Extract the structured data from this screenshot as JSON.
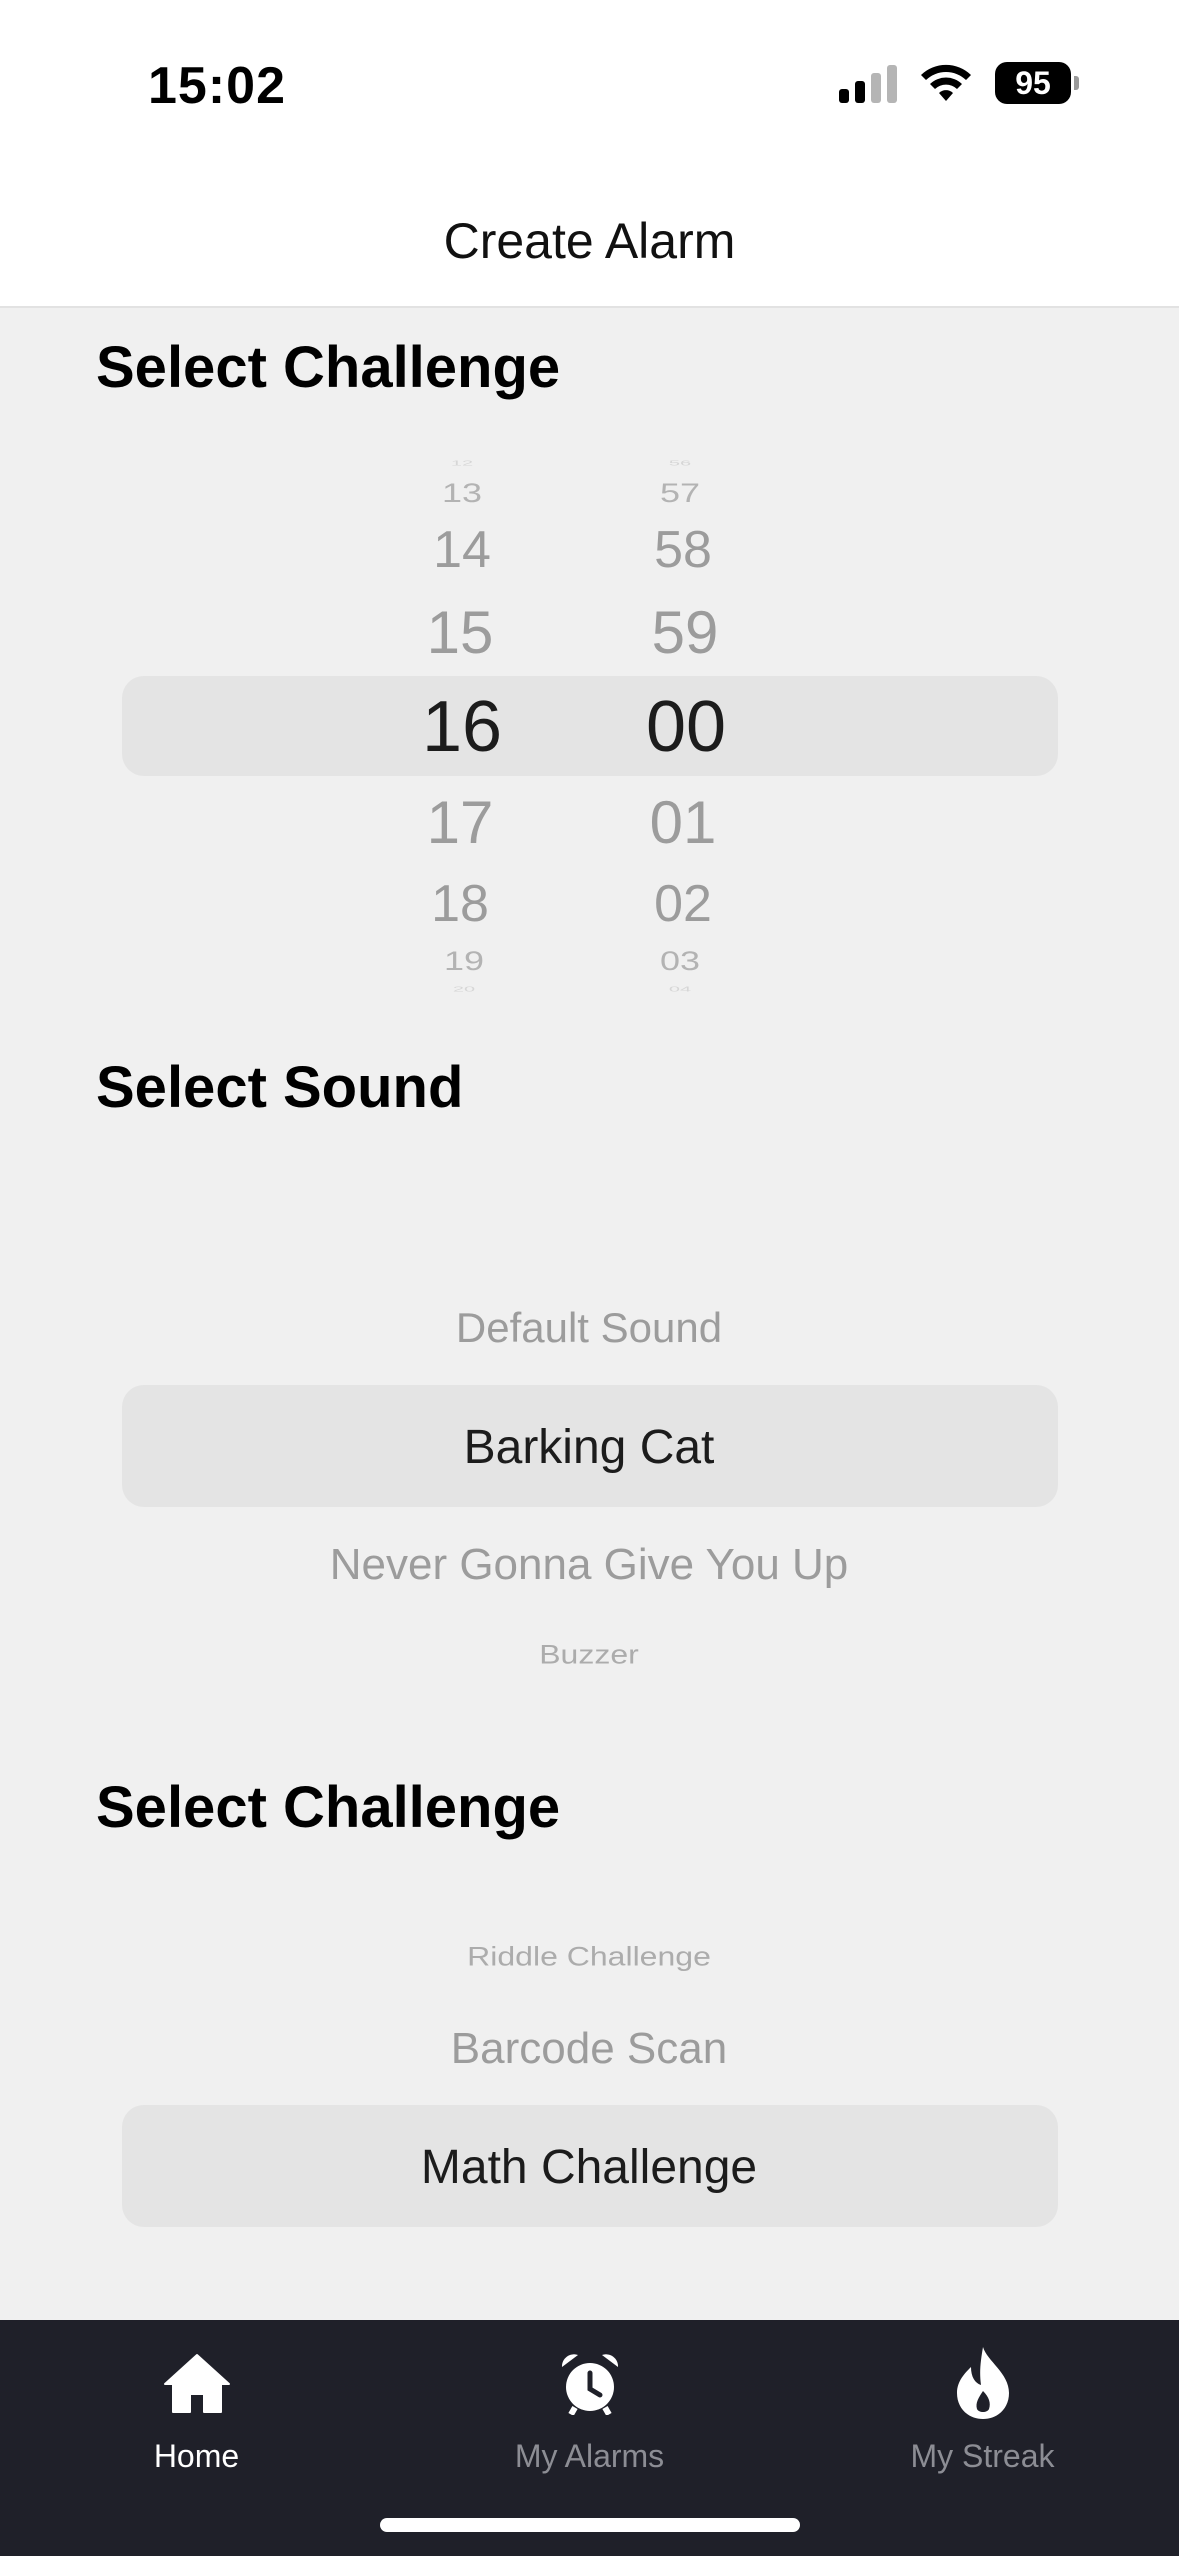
{
  "status_bar": {
    "time": "15:02",
    "battery": "95"
  },
  "nav": {
    "title": "Create Alarm"
  },
  "time_section": {
    "title": "Select Challenge",
    "hours": [
      "12",
      "13",
      "14",
      "15",
      "16",
      "17",
      "18",
      "19",
      "20"
    ],
    "minutes": [
      "56",
      "57",
      "58",
      "59",
      "00",
      "01",
      "02",
      "03",
      "04"
    ],
    "selected_hour": "16",
    "selected_minute": "00"
  },
  "sound_section": {
    "title": "Select Sound",
    "options": [
      "Default Sound",
      "Barking Cat",
      "Never Gonna Give You Up",
      "Buzzer"
    ],
    "selected": "Barking Cat"
  },
  "challenge_section": {
    "title": "Select Challenge",
    "options": [
      "Riddle Challenge",
      "Barcode Scan",
      "Math Challenge"
    ],
    "selected": "Math Challenge"
  },
  "tab_bar": {
    "tabs": [
      {
        "label": "Home",
        "icon": "house-icon",
        "active": true
      },
      {
        "label": "My Alarms",
        "icon": "alarm-clock-icon",
        "active": false
      },
      {
        "label": "My Streak",
        "icon": "flame-icon",
        "active": false
      }
    ]
  },
  "colors": {
    "background": "#f0f0f0",
    "highlight": "#e4e4e4",
    "tab_bar": "#1f2029",
    "inactive_text": "#9c9c9c"
  }
}
